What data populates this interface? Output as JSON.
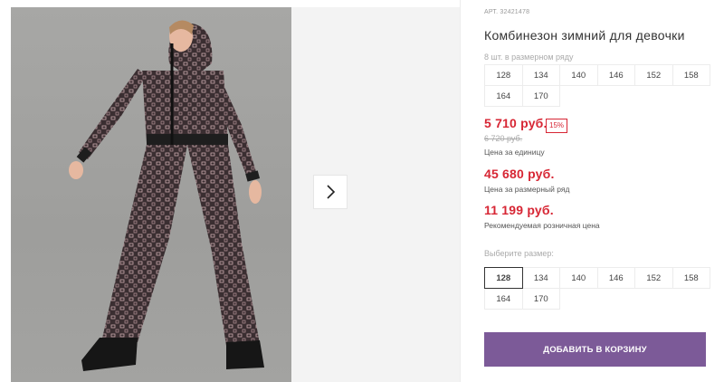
{
  "product": {
    "sku": "АРТ. 32421478",
    "title": "Комбинезон зимний для девочки",
    "pack_hint": "8 шт. в размерном ряду",
    "pack_sizes": [
      "128",
      "134",
      "140",
      "146",
      "152",
      "158",
      "164",
      "170"
    ],
    "price": "5 710 руб.",
    "discount": "15%",
    "old_price": "6 720 руб.",
    "price_caption": "Цена за единицу",
    "pack_price": "45 680 руб.",
    "pack_price_caption": "Цена за размерный ряд",
    "retail_price": "11 199 руб.",
    "retail_caption": "Рекомендуемая розничная цена",
    "select_hint": "Выберите размер:",
    "sizes": [
      "128",
      "134",
      "140",
      "146",
      "152",
      "158",
      "164",
      "170"
    ],
    "selected_size": "128",
    "add_to_cart": "ДОБАВИТЬ В КОРЗИНУ"
  },
  "icons": {
    "next": "chevron-right-icon"
  },
  "colors": {
    "accent": "#7c5a98",
    "price": "#d72634"
  }
}
